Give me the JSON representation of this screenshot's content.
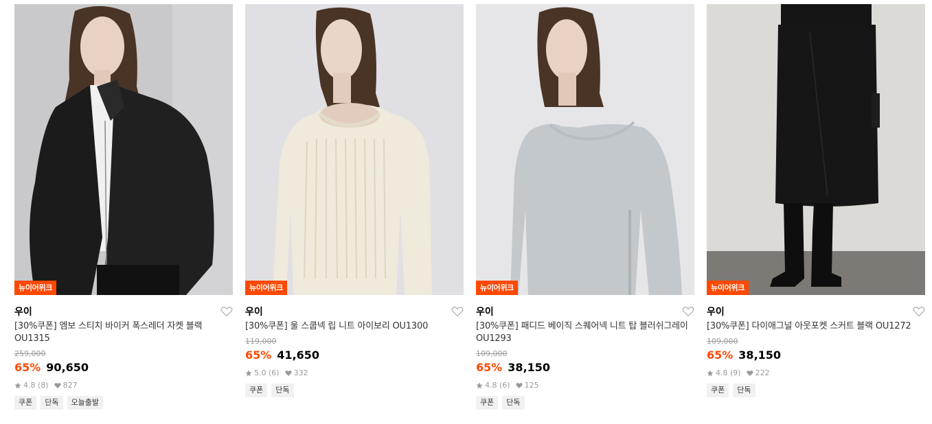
{
  "products": [
    {
      "badge": "뉴이어위크",
      "brand": "우이",
      "title": "[30%쿠폰] 엠보 스티치 바이커 폭스레더 자켓 블랙 OU1315",
      "original_price": "259,000",
      "discount": "65%",
      "price": "90,650",
      "rating": "4.8 (8)",
      "likes": "827",
      "tags": [
        "쿠폰",
        "단독",
        "오늘출발"
      ],
      "image_colors": {
        "bg": "#c9c9cc",
        "garment": "#1b1b1b",
        "inner": "#f0f0f0",
        "hair": "#4a3426",
        "skin": "#e9d2c3"
      }
    },
    {
      "badge": "뉴이어위크",
      "brand": "우이",
      "title": "[30%쿠폰] 울 스쿱넥 립 니트 아이보리 OU1300",
      "original_price": "119,000",
      "discount": "65%",
      "price": "41,650",
      "rating": "5.0 (6)",
      "likes": "332",
      "tags": [
        "쿠폰",
        "단독"
      ],
      "image_colors": {
        "bg": "#e0dfe3",
        "garment": "#efeadb",
        "inner": "#efeadb",
        "hair": "#4a3426",
        "skin": "#ead6c8"
      }
    },
    {
      "badge": "뉴이어위크",
      "brand": "우이",
      "title": "[30%쿠폰] 패디드 베이직 스퀘어넥 니트 탑 블러쉬그레이 OU1293",
      "original_price": "109,000",
      "discount": "65%",
      "price": "38,150",
      "rating": "4.8 (6)",
      "likes": "125",
      "tags": [
        "쿠폰",
        "단독"
      ],
      "image_colors": {
        "bg": "#e6e6e8",
        "garment": "#c3c8cc",
        "inner": "#c3c8cc",
        "hair": "#4a3426",
        "skin": "#e9d2c3"
      }
    },
    {
      "badge": "뉴이어위크",
      "brand": "우이",
      "title": "[30%쿠폰] 다이애그널 아웃포켓 스커트 블랙 OU1272",
      "original_price": "109,000",
      "discount": "65%",
      "price": "38,150",
      "rating": "4.8 (9)",
      "likes": "222",
      "tags": [
        "쿠폰",
        "단독"
      ],
      "image_colors": {
        "bg": "#dcdad6",
        "garment": "#161616",
        "inner": "#161616",
        "hair": "#4a3426",
        "skin": "#e9d2c3",
        "floor": "#7d7a75"
      }
    }
  ],
  "colors": {
    "accent": "#ff4800",
    "muted": "#999999"
  }
}
